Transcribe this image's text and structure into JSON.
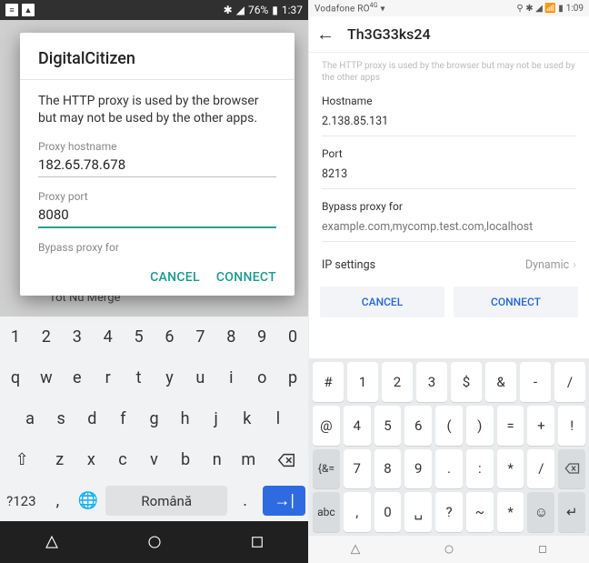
{
  "left": {
    "statusbar": {
      "battery": "76%",
      "time": "1:37"
    },
    "bg_ghost": "Tot Nu Merge",
    "dialog": {
      "title": "DigitalCitizen",
      "desc": "The HTTP proxy is used by the browser but may not be used by the other apps.",
      "hostname_label": "Proxy hostname",
      "hostname_value": "182.65.78.678",
      "port_label": "Proxy port",
      "port_value": "8080",
      "bypass_label": "Bypass proxy for",
      "cancel": "CANCEL",
      "connect": "CONNECT"
    },
    "keyboard": {
      "row1": [
        "1",
        "2",
        "3",
        "4",
        "5",
        "6",
        "7",
        "8",
        "9",
        "0"
      ],
      "row2": [
        "q",
        "w",
        "e",
        "r",
        "t",
        "y",
        "u",
        "i",
        "o",
        "p"
      ],
      "row3": [
        "a",
        "s",
        "d",
        "f",
        "g",
        "h",
        "j",
        "k",
        "l"
      ],
      "row4": [
        "z",
        "x",
        "c",
        "v",
        "b",
        "n",
        "m"
      ],
      "symbols": "?123",
      "comma": ",",
      "period": ".",
      "space_label": "Română"
    }
  },
  "right": {
    "statusbar": {
      "carrier": "Vodafone RO",
      "time": "1:09"
    },
    "header_title": "Th3G33ks24",
    "hint": "The HTTP proxy is used by the browser but may not be used by the other apps",
    "hostname_label": "Hostname",
    "hostname_value": "2.138.85.131",
    "port_label": "Port",
    "port_value": "8213",
    "bypass_label": "Bypass proxy for",
    "bypass_placeholder": "example.com,mycomp.test.com,localhost",
    "ip_label": "IP settings",
    "ip_value": "Dynamic",
    "cancel": "CANCEL",
    "connect": "CONNECT",
    "keyboard": {
      "row1": [
        "#",
        "1",
        "2",
        "3",
        "$",
        "&",
        "-",
        "/"
      ],
      "row2": [
        "@",
        "4",
        "5",
        "6",
        "(",
        ")",
        "=",
        "+",
        "!"
      ],
      "row3": [
        "{&=",
        "7",
        "8",
        "9",
        ".",
        ":",
        "*",
        "/"
      ],
      "row4": [
        "abc",
        ",",
        "0",
        "␣",
        "?",
        "~",
        "*"
      ]
    }
  }
}
